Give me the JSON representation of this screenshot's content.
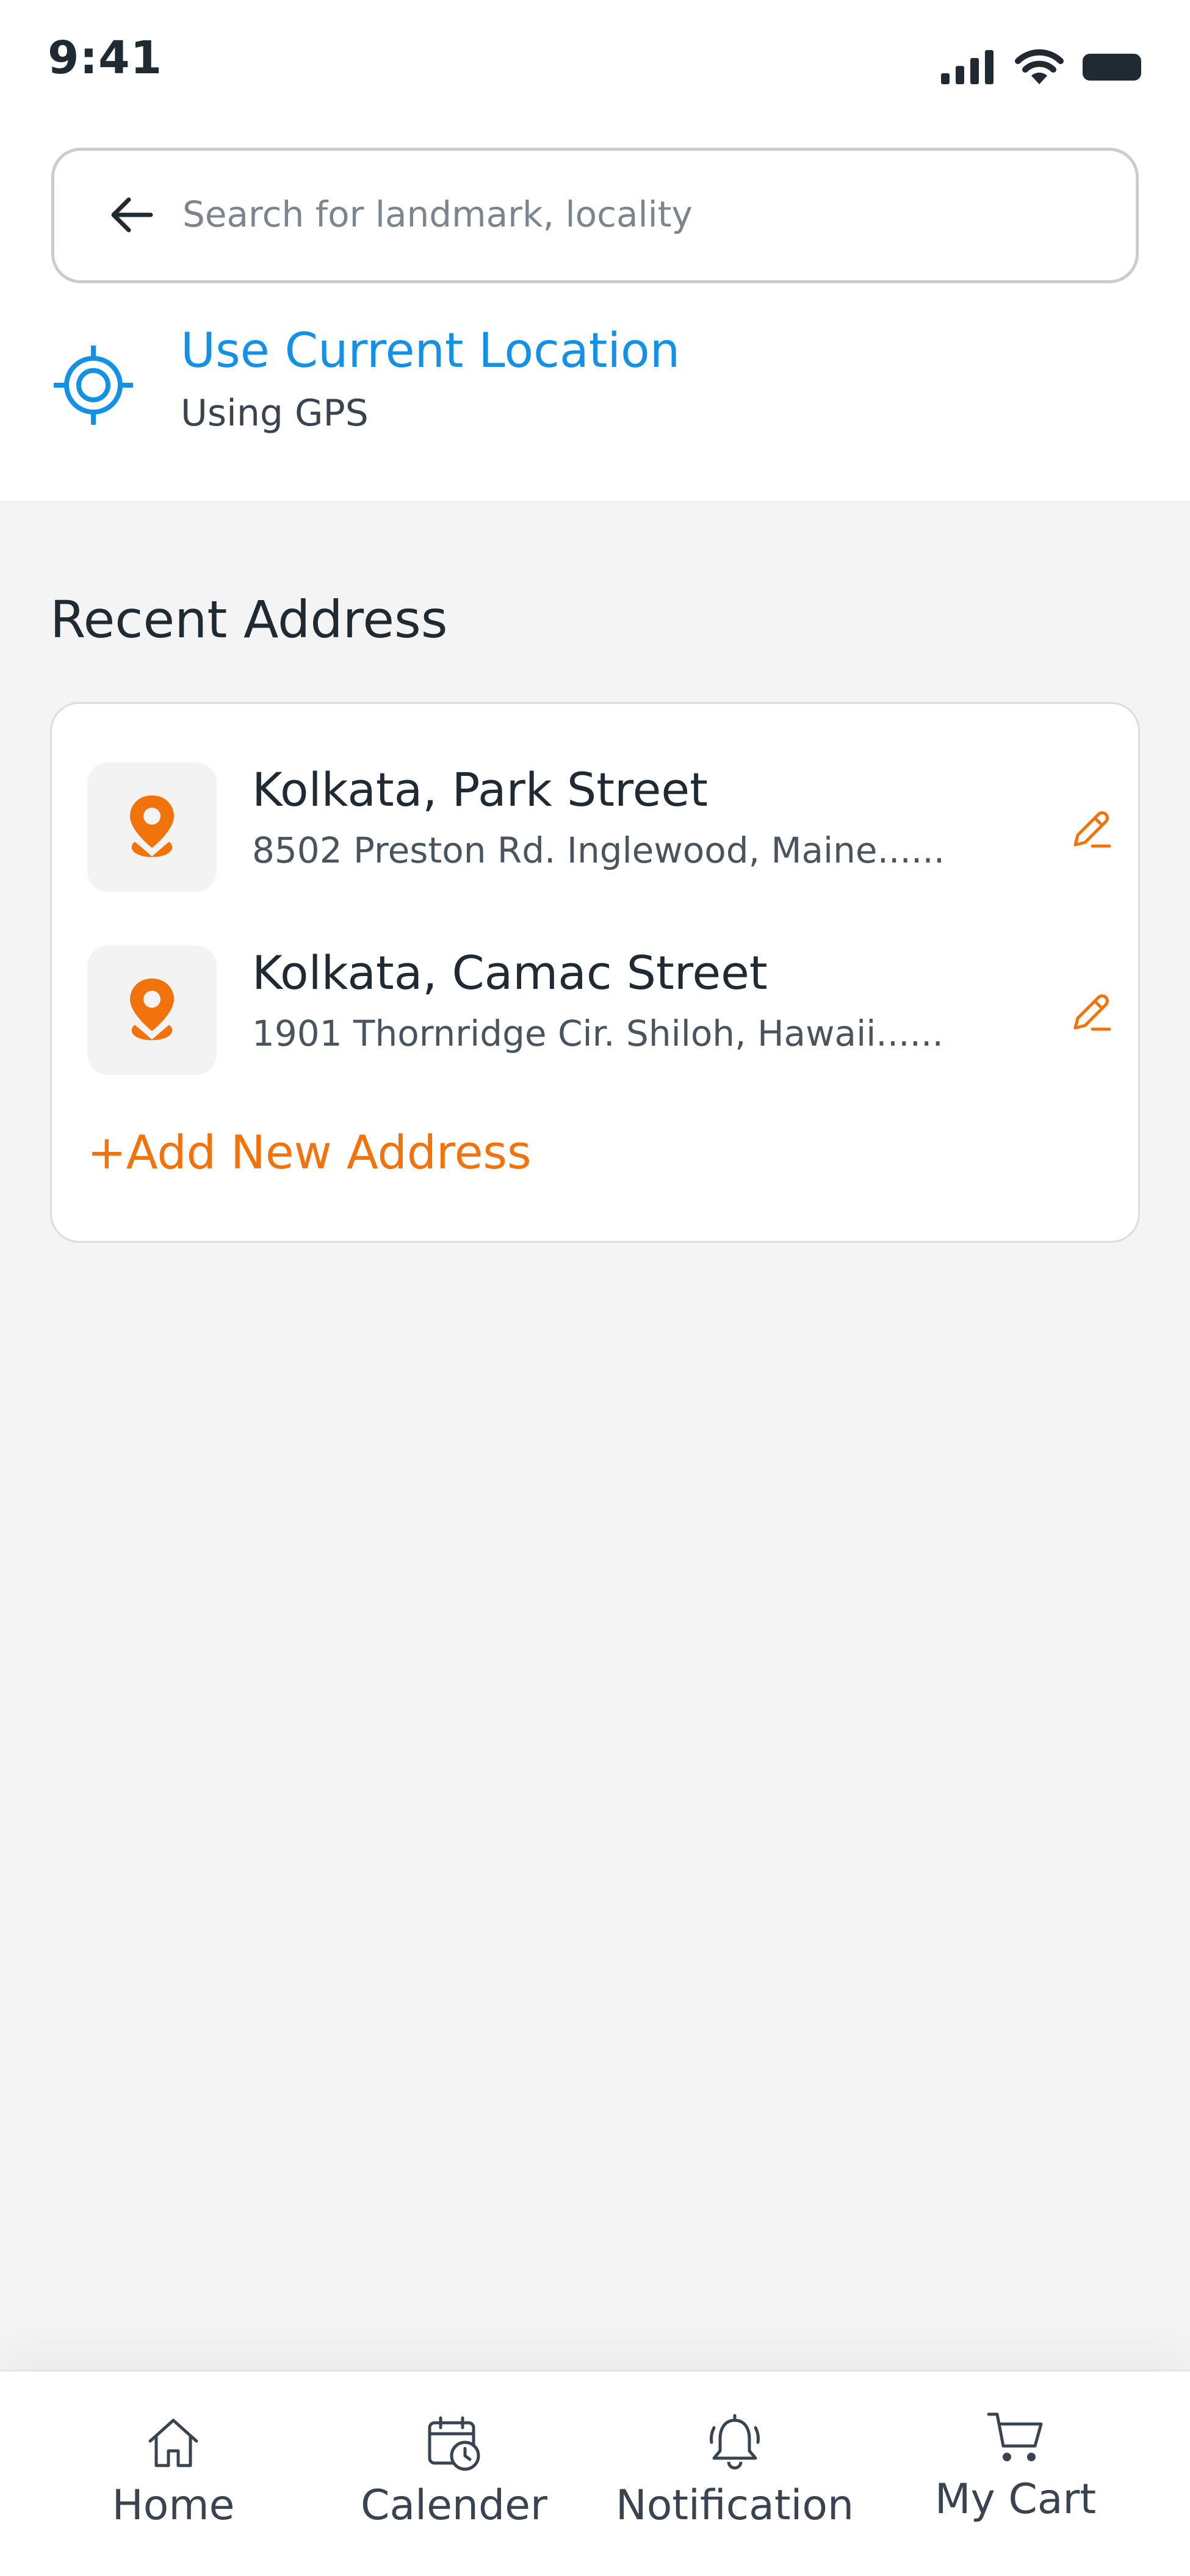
{
  "status_bar": {
    "time": "9:41"
  },
  "search": {
    "placeholder": "Search for landmark, locality",
    "value": ""
  },
  "current_location": {
    "title": "Use Current Location",
    "subtitle": "Using GPS"
  },
  "recent": {
    "title": "Recent Address",
    "addresses": [
      {
        "title": "Kolkata, Park Street",
        "subtitle": "8502 Preston Rd. Inglewood, Maine......"
      },
      {
        "title": "Kolkata, Camac Street",
        "subtitle": "1901 Thornridge Cir. Shiloh, Hawaii......"
      }
    ],
    "add_label": "+Add New Address"
  },
  "bottom_nav": {
    "items": [
      {
        "label": "Home",
        "icon": "home-icon"
      },
      {
        "label": "Calender",
        "icon": "calendar-clock-icon"
      },
      {
        "label": "Notification",
        "icon": "bell-icon"
      },
      {
        "label": "My Cart",
        "icon": "cart-icon"
      }
    ]
  },
  "colors": {
    "accent_blue": "#1291e6",
    "accent_orange": "#f2720c",
    "background": "#f4f4f4",
    "text_dark": "#1f2a33"
  }
}
